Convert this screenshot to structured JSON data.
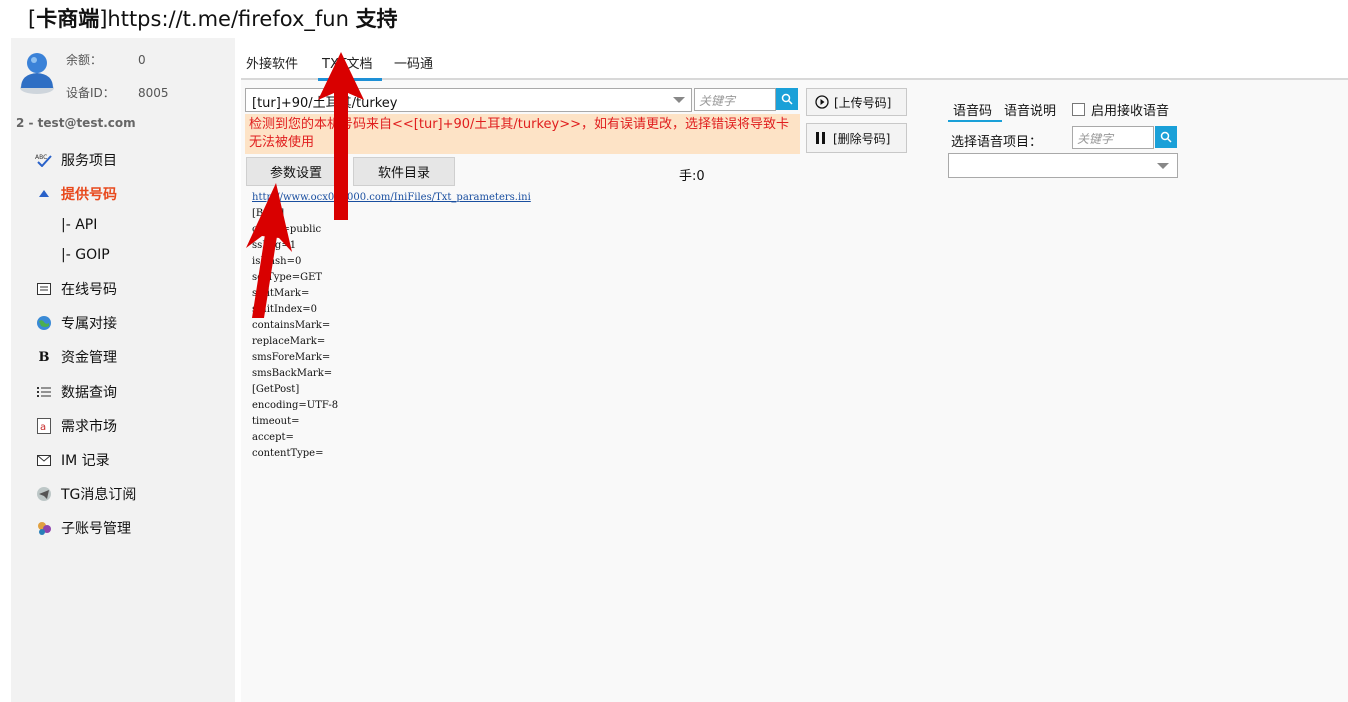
{
  "title": {
    "bracket_open": "[",
    "app_name": "卡商端",
    "middle": "]https://t.me/firefox_fun ",
    "suffix": "支持"
  },
  "account": {
    "balance_label": "余额：",
    "balance_value": "0",
    "device_label": "设备ID：",
    "device_value": "8005",
    "user": "2 - test@test.com"
  },
  "sidebar": {
    "items": [
      {
        "label": "服务项目",
        "icon": "abc-check-icon"
      },
      {
        "label": "提供号码",
        "icon": "up-arrow-icon",
        "active": true
      },
      {
        "label": "在线号码",
        "icon": "list-card-icon"
      },
      {
        "label": "专属对接",
        "icon": "globe-icon"
      },
      {
        "label": "资金管理",
        "icon": "bold-b-icon"
      },
      {
        "label": "数据查询",
        "icon": "list-lines-icon"
      },
      {
        "label": "需求市场",
        "icon": "at-doc-icon"
      },
      {
        "label": "IM 记录",
        "icon": "envelope-icon"
      },
      {
        "label": "TG消息订阅",
        "icon": "telegram-icon"
      },
      {
        "label": "子账号管理",
        "icon": "users-icon"
      }
    ],
    "subitems": [
      "|-  API",
      "|-  GOIP"
    ]
  },
  "tabs": [
    "外接软件",
    "TXT文档",
    "一码通"
  ],
  "active_tab": "TXT文档",
  "project_select": {
    "value": "[tur]+90/土耳其/turkey"
  },
  "search": {
    "placeholder": "关键字"
  },
  "warning": {
    "line1": "检测到您的本机号码来自<<[tur]+90/土耳其/turkey>>，如有误请更改，选择错误将导致卡",
    "line2": "无法被使用"
  },
  "buttons": {
    "upload": "[上传号码]",
    "delete": "[删除号码]",
    "params": "参数设置",
    "software_dir": "软件目录"
  },
  "counter": "手:0",
  "config": {
    "url": "http://www.ocx000000.com/IniFiles/Txt_parameters.ini",
    "lines": [
      "[Base]",
      "codec=public",
      "ssLog=1",
      "isHash=0",
      "setType=GET",
      "splitMark=",
      "splitIndex=0",
      "containsMark=",
      "replaceMark=",
      "smsForeMark=",
      "smsBackMark=",
      "[GetPost]",
      "encoding=UTF-8",
      "timeout=",
      "accept=",
      "contentType="
    ]
  },
  "voice": {
    "tab1": "语音码",
    "tab2": "语音说明",
    "enable_label": "启用接收语音",
    "select_label": "选择语音项目：",
    "search_placeholder": "关键字",
    "select_value": ""
  },
  "colors": {
    "accent": "#1aa0d8",
    "active_nav": "#e8491d",
    "warning_bg": "#fde3c6",
    "warning_text": "#e01e1e",
    "annotation_arrow": "#d90000"
  }
}
